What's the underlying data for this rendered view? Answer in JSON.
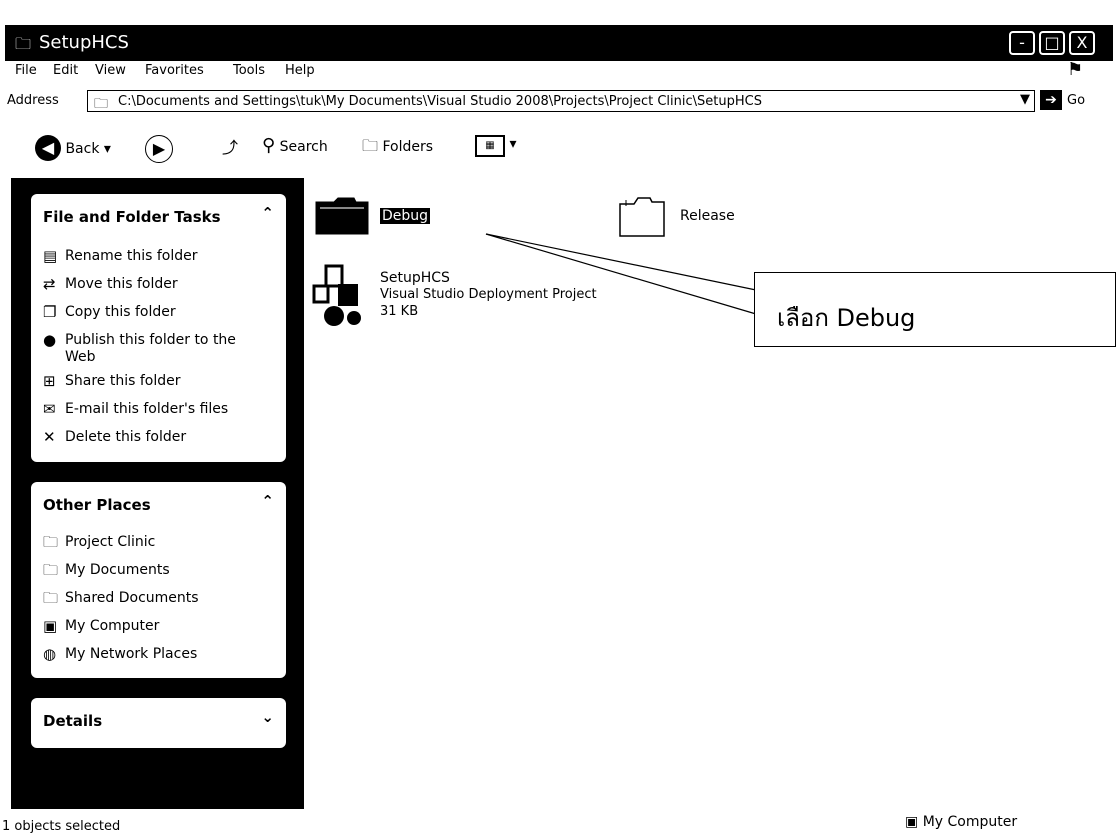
{
  "window": {
    "title": "SetupHCS",
    "min_glyph": "-",
    "max_glyph": "□",
    "close_glyph": "X"
  },
  "menu": {
    "items": [
      {
        "label": "File"
      },
      {
        "label": "Edit"
      },
      {
        "label": "View"
      },
      {
        "label": "Favorites"
      },
      {
        "label": "Tools"
      },
      {
        "label": "Help"
      }
    ]
  },
  "address": {
    "label": "Address",
    "path": "C:\\Documents and Settings\\tuk\\My Documents\\Visual Studio 2008\\Projects\\Project Clinic\\SetupHCS",
    "go_label": "Go"
  },
  "toolbar": {
    "back_label": "Back",
    "search_label": "Search",
    "folders_label": "Folders"
  },
  "sidebar": {
    "file_folder_tasks": {
      "title": "File and Folder Tasks",
      "chevron": "⌃",
      "items": [
        {
          "label": "Rename this folder",
          "icon": "rename-icon"
        },
        {
          "label": "Move this folder",
          "icon": "move-icon"
        },
        {
          "label": "Copy this folder",
          "icon": "copy-icon"
        },
        {
          "label": "Publish this folder to the Web",
          "icon": "publish-icon"
        },
        {
          "label": "Share this folder",
          "icon": "share-icon"
        },
        {
          "label": "E-mail this folder's files",
          "icon": "email-icon"
        },
        {
          "label": "Delete this folder",
          "icon": "delete-icon"
        }
      ]
    },
    "other_places": {
      "title": "Other Places",
      "chevron": "⌃",
      "items": [
        {
          "label": "Project Clinic",
          "icon": "folder-icon"
        },
        {
          "label": "My Documents",
          "icon": "documents-icon"
        },
        {
          "label": "Shared Documents",
          "icon": "folder-icon"
        },
        {
          "label": "My Computer",
          "icon": "computer-icon"
        },
        {
          "label": "My Network Places",
          "icon": "network-icon"
        }
      ]
    },
    "details": {
      "title": "Details",
      "chevron": "⌄"
    }
  },
  "content": {
    "items": [
      {
        "name": "Debug",
        "type": "folder",
        "selected": true
      },
      {
        "name": "Release",
        "type": "folder",
        "selected": false
      },
      {
        "name": "SetupHCS",
        "desc": "Visual Studio Deployment Project",
        "size": "31 KB"
      }
    ]
  },
  "callout": {
    "text": "เลือก Debug"
  },
  "status": {
    "left": "1 objects selected",
    "right": "My Computer"
  }
}
